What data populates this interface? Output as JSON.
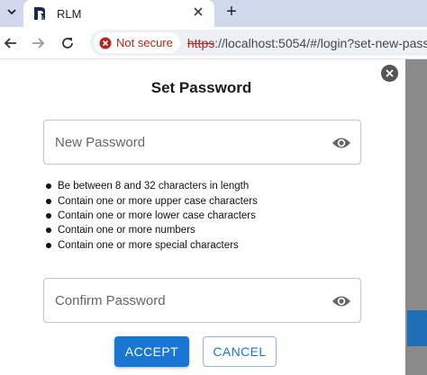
{
  "browser": {
    "tab": {
      "title": "RLM"
    },
    "new_tab_symbol": "+",
    "security_label": "Not secure",
    "url": {
      "scheme": "https",
      "rest": "://localhost:5054/#/login?set-new-password"
    }
  },
  "dialog": {
    "title": "Set Password",
    "new_password": {
      "placeholder": "New Password",
      "value": ""
    },
    "rules": [
      "Be between 8 and 32 characters in length",
      "Contain one or more upper case characters",
      "Contain one or more lower case characters",
      "Contain one or more numbers",
      "Contain one or more special characters"
    ],
    "confirm_password": {
      "placeholder": "Confirm Password",
      "value": ""
    },
    "accept_label": "ACCEPT",
    "cancel_label": "CANCEL"
  },
  "colors": {
    "primary": "#1976d2",
    "warning_red": "#b3261e",
    "tab_strip": "#cfd8ec",
    "backdrop": "#8a8a8a"
  },
  "icons": {
    "tab_menu": "chevron-down-icon",
    "favicon": "rlm-logo-icon",
    "tab_close": "close-icon",
    "back": "arrow-left-icon",
    "forward": "arrow-right-icon",
    "reload": "reload-icon",
    "security": "warning-circle-icon",
    "dialog_close": "close-circle-icon",
    "password_visibility": "eye-icon"
  }
}
